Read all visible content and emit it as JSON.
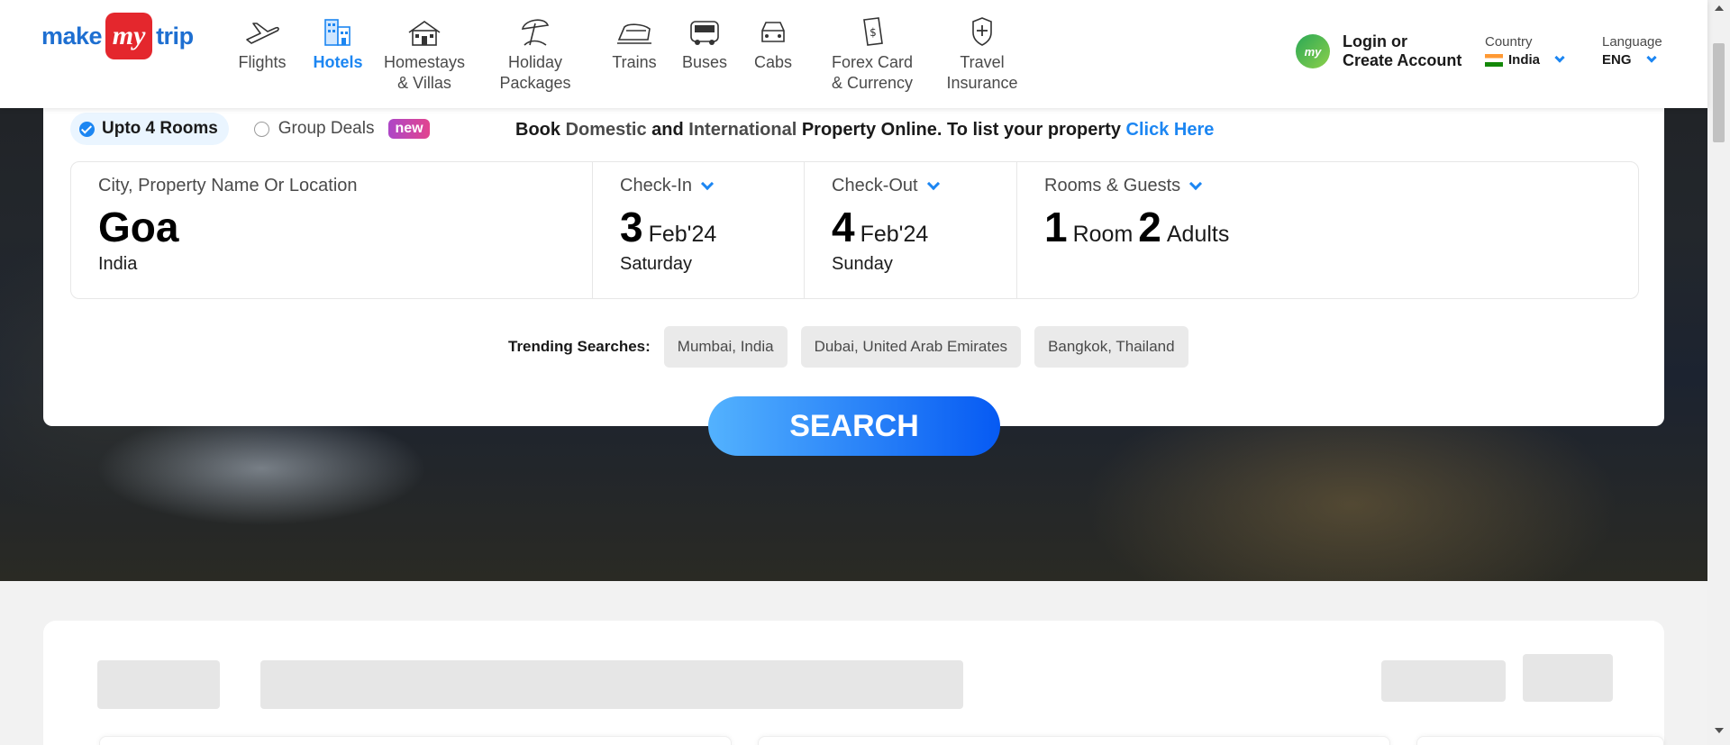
{
  "brand": {
    "left": "make",
    "mid": "my",
    "right": "trip"
  },
  "nav": [
    {
      "label": "Flights",
      "icon": "plane-icon"
    },
    {
      "label": "Hotels",
      "icon": "hotel-icon",
      "active": true
    },
    {
      "label": "Homestays\n& Villas",
      "icon": "homestay-icon"
    },
    {
      "label": "Holiday\nPackages",
      "icon": "umbrella-icon"
    },
    {
      "label": "Trains",
      "icon": "train-icon"
    },
    {
      "label": "Buses",
      "icon": "bus-icon"
    },
    {
      "label": "Cabs",
      "icon": "cab-icon"
    },
    {
      "label": "Forex Card\n& Currency",
      "icon": "forex-icon"
    },
    {
      "label": "Travel\nInsurance",
      "icon": "insurance-icon"
    }
  ],
  "account": {
    "line1": "Login or",
    "line2": "Create Account",
    "avatar": "my"
  },
  "country": {
    "label": "Country",
    "value": "India"
  },
  "language": {
    "label": "Language",
    "value": "ENG"
  },
  "options": {
    "rooms": "Upto 4 Rooms",
    "group": "Group Deals",
    "badge": "new"
  },
  "promo": {
    "p1": "Book ",
    "p2": "Domestic",
    "p3": " and ",
    "p4": "International",
    "p5": " Property Online. To list your property ",
    "link": "Click Here"
  },
  "search": {
    "city_label": "City, Property Name Or Location",
    "city": "Goa",
    "country": "India",
    "checkin_label": "Check-In",
    "checkin_day": "3",
    "checkin_month": "Feb'24",
    "checkin_weekday": "Saturday",
    "checkout_label": "Check-Out",
    "checkout_day": "4",
    "checkout_month": "Feb'24",
    "checkout_weekday": "Sunday",
    "guests_label": "Rooms & Guests",
    "rooms_num": "1",
    "rooms_word": "Room",
    "adults_num": "2",
    "adults_word": "Adults"
  },
  "trending": {
    "label": "Trending Searches:",
    "items": [
      "Mumbai, India",
      "Dubai, United Arab Emirates",
      "Bangkok, Thailand"
    ]
  },
  "button": {
    "search": "SEARCH"
  },
  "colors": {
    "accent": "#1c86f2",
    "brand_red": "#e4272d",
    "button_start": "#53b2fe",
    "button_end": "#065af3"
  }
}
